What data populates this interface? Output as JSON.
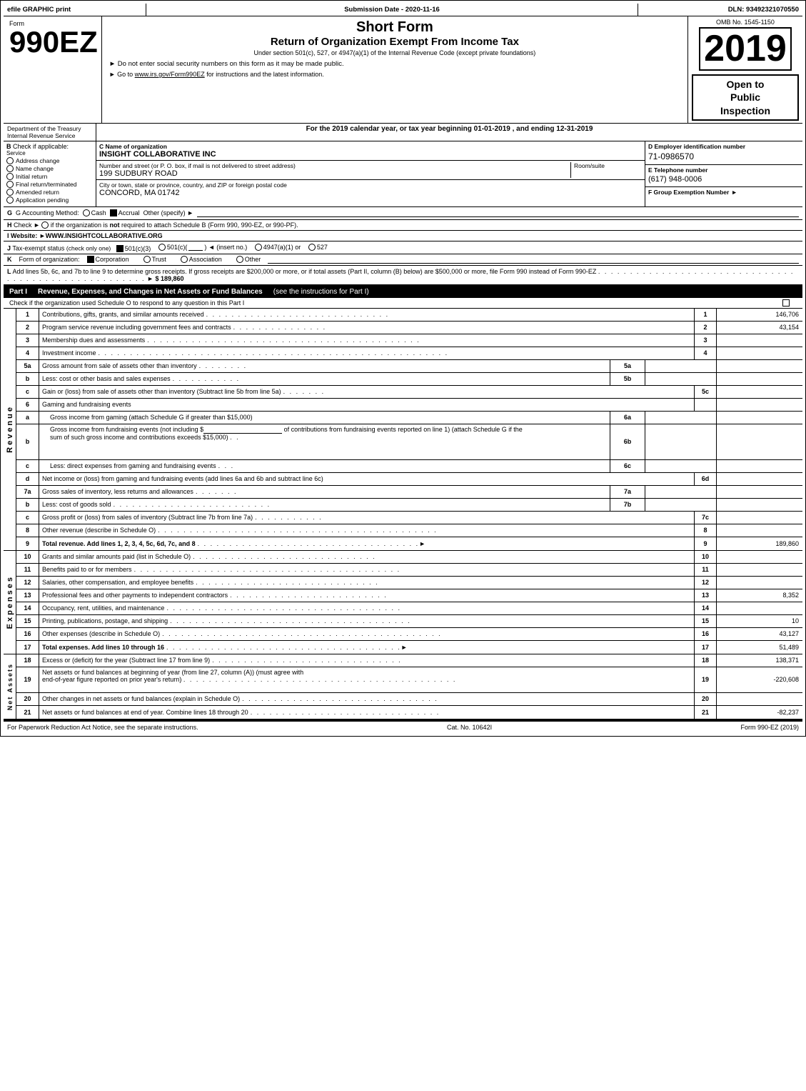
{
  "header": {
    "efile": "efile GRAPHIC print",
    "submission_label": "Submission Date -",
    "submission_date": "2020-11-16",
    "dln_label": "DLN:",
    "dln": "93492321070550"
  },
  "form": {
    "number": "990EZ",
    "form_label": "Form",
    "small_label": "",
    "title_short": "Short Form",
    "title_return": "Return of Organization Exempt From Income Tax",
    "under_section": "Under section 501(c), 527, or 4947(a)(1) of the Internal Revenue Code (except private foundations)",
    "no_ssn": "► Do not enter social security numbers on this form as it may be made public.",
    "goto": "► Go to www.irs.gov/Form990EZ for instructions and the latest information.",
    "omb_label": "OMB No. 1545-1150",
    "year": "2019",
    "open_to_public": "Open to\nPublic\nInspection",
    "dept": "Department of the Treasury",
    "irs": "Internal Revenue Service"
  },
  "year_line": "For the 2019 calendar year, or tax year beginning 01-01-2019 , and ending 12-31-2019",
  "check_applicable": {
    "label_b": "B Check if applicable:",
    "items": [
      "Address change",
      "Name change",
      "Initial return",
      "Final return/terminated",
      "Amended return",
      "Application pending"
    ]
  },
  "org": {
    "label_c": "C Name of organization",
    "name": "INSIGHT COLLABORATIVE INC",
    "label_d": "D Employer identification number",
    "ein": "71-0986570",
    "label_address": "Number and street (or P. O. box, if mail is not delivered to street address)",
    "address": "199 SUDBURY ROAD",
    "room_suite_label": "Room/suite",
    "room_suite": "",
    "label_e": "E Telephone number",
    "phone": "(617) 948-0006",
    "label_city": "City or town, state or province, country, and ZIP or foreign postal code",
    "city": "CONCORD, MA  01742",
    "label_f": "F Group Exemption Number",
    "group_exemption": ""
  },
  "accounting": {
    "label_g": "G Accounting Method:",
    "cash": "Cash",
    "accrual": "Accrual",
    "accrual_checked": true,
    "other": "Other (specify) ►"
  },
  "website": {
    "label_i": "I Website: ►",
    "url": "WWW.INSIGHTCOLLABORATIVE.ORG"
  },
  "tax_exempt": {
    "label_j": "J Tax-exempt status",
    "check_only": "(check only one)",
    "options": [
      "501(c)(3)",
      "501(c)(",
      ") ◄ (insert no.)",
      "4947(a)(1) or",
      "527"
    ],
    "c3_checked": true
  },
  "form_org": {
    "label_k": "K Form of organization:",
    "options": [
      "Corporation",
      "Trust",
      "Association",
      "Other"
    ],
    "corp_checked": true
  },
  "line_l": {
    "text": "L Add lines 5b, 6c, and 7b to line 9 to determine gross receipts. If gross receipts are $200,000 or more, or if total assets (Part II, column (B) below) are $500,000 or more, file Form 990 instead of Form 990-EZ",
    "dots": ". . . . . . . . . . . . . . . . . . . . . . . . . . . . . . . . . . . . . . . . . . . . . . . . . . . . .",
    "arrow": "►",
    "amount": "$ 189,860"
  },
  "part1": {
    "label": "Part I",
    "title": "Revenue, Expenses, and Changes in Net Assets or Fund Balances",
    "see_instructions": "(see the instructions for Part I)",
    "schedule_o_check": "Check if the organization used Schedule O to respond to any question in this Part I",
    "lines": [
      {
        "num": "1",
        "desc": "Contributions, gifts, grants, and similar amounts received",
        "dots": ". . . . . . . . . . . . . . . . . . . . . . . . . . . . .",
        "ref": "1",
        "amount": "146,706"
      },
      {
        "num": "2",
        "desc": "Program service revenue including government fees and contracts",
        "dots": ". . . . . . . . . . . . . . .",
        "ref": "2",
        "amount": "43,154"
      },
      {
        "num": "3",
        "desc": "Membership dues and assessments",
        "dots": ". . . . . . . . . . . . . . . . . . . . . . . . . . . . . . . . . . . . . . . . . . .",
        "ref": "3",
        "amount": ""
      },
      {
        "num": "4",
        "desc": "Investment income",
        "dots": ". . . . . . . . . . . . . . . . . . . . . . . . . . . . . . . . . . . . . . . . . . . . . . . . . . . . . . .",
        "ref": "4",
        "amount": ""
      },
      {
        "num": "5a",
        "desc": "Gross amount from sale of assets other than inventory",
        "dots": ". . . . . . . .",
        "ref": "5a",
        "amount": "",
        "inline_ref": true
      },
      {
        "num": "b",
        "desc": "Less: cost or other basis and sales expenses",
        "dots": ". . . . . . . . . . .",
        "ref": "5b",
        "amount": "",
        "inline_ref": true
      },
      {
        "num": "c",
        "desc": "Gain or (loss) from sale of assets other than inventory (Subtract line 5b from line 5a)",
        "dots": ". . . . . . .",
        "ref": "5c",
        "amount": ""
      },
      {
        "num": "6",
        "desc": "Gaming and fundraising events",
        "dots": "",
        "ref": "",
        "amount": "",
        "no_ref": true
      },
      {
        "num": "a",
        "desc": "Gross income from gaming (attach Schedule G if greater than $15,000)",
        "dots": "",
        "ref": "6a",
        "amount": "",
        "inline_ref": true
      },
      {
        "num": "b",
        "desc": "Gross income from fundraising events (not including $                    of contributions from fundraising events reported on line 1) (attach Schedule G if the sum of such gross income and contributions exceeds $15,000)",
        "dots": ". .",
        "ref": "6b",
        "amount": "",
        "inline_ref": true,
        "multiline": true
      },
      {
        "num": "c",
        "desc": "Less: direct expenses from gaming and fundraising events",
        "dots": ". . .",
        "ref": "6c",
        "amount": "",
        "inline_ref": true
      },
      {
        "num": "d",
        "desc": "Net income or (loss) from gaming and fundraising events (add lines 6a and 6b and subtract line 6c)",
        "dots": "",
        "ref": "6d",
        "amount": ""
      },
      {
        "num": "7a",
        "desc": "Gross sales of inventory, less returns and allowances",
        "dots": ". . . . . . .",
        "ref": "7a",
        "amount": "",
        "inline_ref": true
      },
      {
        "num": "b",
        "desc": "Less: cost of goods sold",
        "dots": ". . . . . . . . . . . . . . . . . . . . . . . . .",
        "ref": "7b",
        "amount": "",
        "inline_ref": true
      },
      {
        "num": "c",
        "desc": "Gross profit or (loss) from sales of inventory (Subtract line 7b from line 7a)",
        "dots": ". . . . . . . . . . .",
        "ref": "7c",
        "amount": ""
      },
      {
        "num": "8",
        "desc": "Other revenue (describe in Schedule O)",
        "dots": ". . . . . . . . . . . . . . . . . . . . . . . . . . . . . . . . . . . . . . . . . . . .",
        "ref": "8",
        "amount": ""
      },
      {
        "num": "9",
        "desc": "Total revenue. Add lines 1, 2, 3, 4, 5c, 6d, 7c, and 8",
        "dots": ". . . . . . . . . . . . . . . . . . . . . . . . . . . . . . . . . . . .",
        "arrow": "►",
        "ref": "9",
        "amount": "189,860",
        "bold": true
      }
    ]
  },
  "expenses": {
    "lines": [
      {
        "num": "10",
        "desc": "Grants and similar amounts paid (list in Schedule O)",
        "dots": ". . . . . . . . . . . . . . . . . . . . . . . . . . . . .",
        "ref": "10",
        "amount": ""
      },
      {
        "num": "11",
        "desc": "Benefits paid to or for members",
        "dots": ". . . . . . . . . . . . . . . . . . . . . . . . . . . . . . . . . . . . . . . . . .",
        "ref": "11",
        "amount": ""
      },
      {
        "num": "12",
        "desc": "Salaries, other compensation, and employee benefits",
        "dots": ". . . . . . . . . . . . . . . . . . . . . . . . . . . . .",
        "ref": "12",
        "amount": ""
      },
      {
        "num": "13",
        "desc": "Professional fees and other payments to independent contractors",
        "dots": ". . . . . . . . . . . . . . . . . . . . . . . .",
        "ref": "13",
        "amount": "8,352"
      },
      {
        "num": "14",
        "desc": "Occupancy, rent, utilities, and maintenance",
        "dots": ". . . . . . . . . . . . . . . . . . . . . . . . . . . . . . . . . . . . .",
        "ref": "14",
        "amount": ""
      },
      {
        "num": "15",
        "desc": "Printing, publications, postage, and shipping",
        "dots": ". . . . . . . . . . . . . . . . . . . . . . . . . . . . . . . . . . . . . .",
        "ref": "15",
        "amount": "10"
      },
      {
        "num": "16",
        "desc": "Other expenses (describe in Schedule O)",
        "dots": ". . . . . . . . . . . . . . . . . . . . . . . . . . . . . . . . . . . . . . . . . . . .",
        "ref": "16",
        "amount": "43,127"
      },
      {
        "num": "17",
        "desc": "Total expenses. Add lines 10 through 16",
        "dots": ". . . . . . . . . . . . . . . . . . . . . . . . . . . . . . . . . . . . .",
        "arrow": "►",
        "ref": "17",
        "amount": "51,489",
        "bold": true
      }
    ]
  },
  "net_assets": {
    "lines": [
      {
        "num": "18",
        "desc": "Excess or (deficit) for the year (Subtract line 17 from line 9)",
        "dots": ". . . . . . . . . . . . . . . . . . . . . . . . . . . . . .",
        "ref": "18",
        "amount": "138,371"
      },
      {
        "num": "19",
        "desc": "Net assets or fund balances at beginning of year (from line 27, column (A)) (must agree with end-of-year figure reported on prior year's return)",
        "dots": ". . . . . . . . . . . . . . . . . . . . . . . . . . . . . . . . . . . . . . . . . . .",
        "ref": "19",
        "amount": "-220,608"
      },
      {
        "num": "20",
        "desc": "Other changes in net assets or fund balances (explain in Schedule O)",
        "dots": ". . . . . . . . . . . . . . . . . . . . . . . . . . . . . . .",
        "ref": "20",
        "amount": ""
      },
      {
        "num": "21",
        "desc": "Net assets or fund balances at end of year. Combine lines 18 through 20",
        "dots": ". . . . . . . . . . . . . . . . . . . . . . . . . . . . . .",
        "ref": "21",
        "amount": "-82,237"
      }
    ]
  },
  "footer": {
    "paperwork": "For Paperwork Reduction Act Notice, see the separate instructions.",
    "cat_no": "Cat. No. 10642I",
    "form_label": "Form 990-EZ (2019)"
  }
}
